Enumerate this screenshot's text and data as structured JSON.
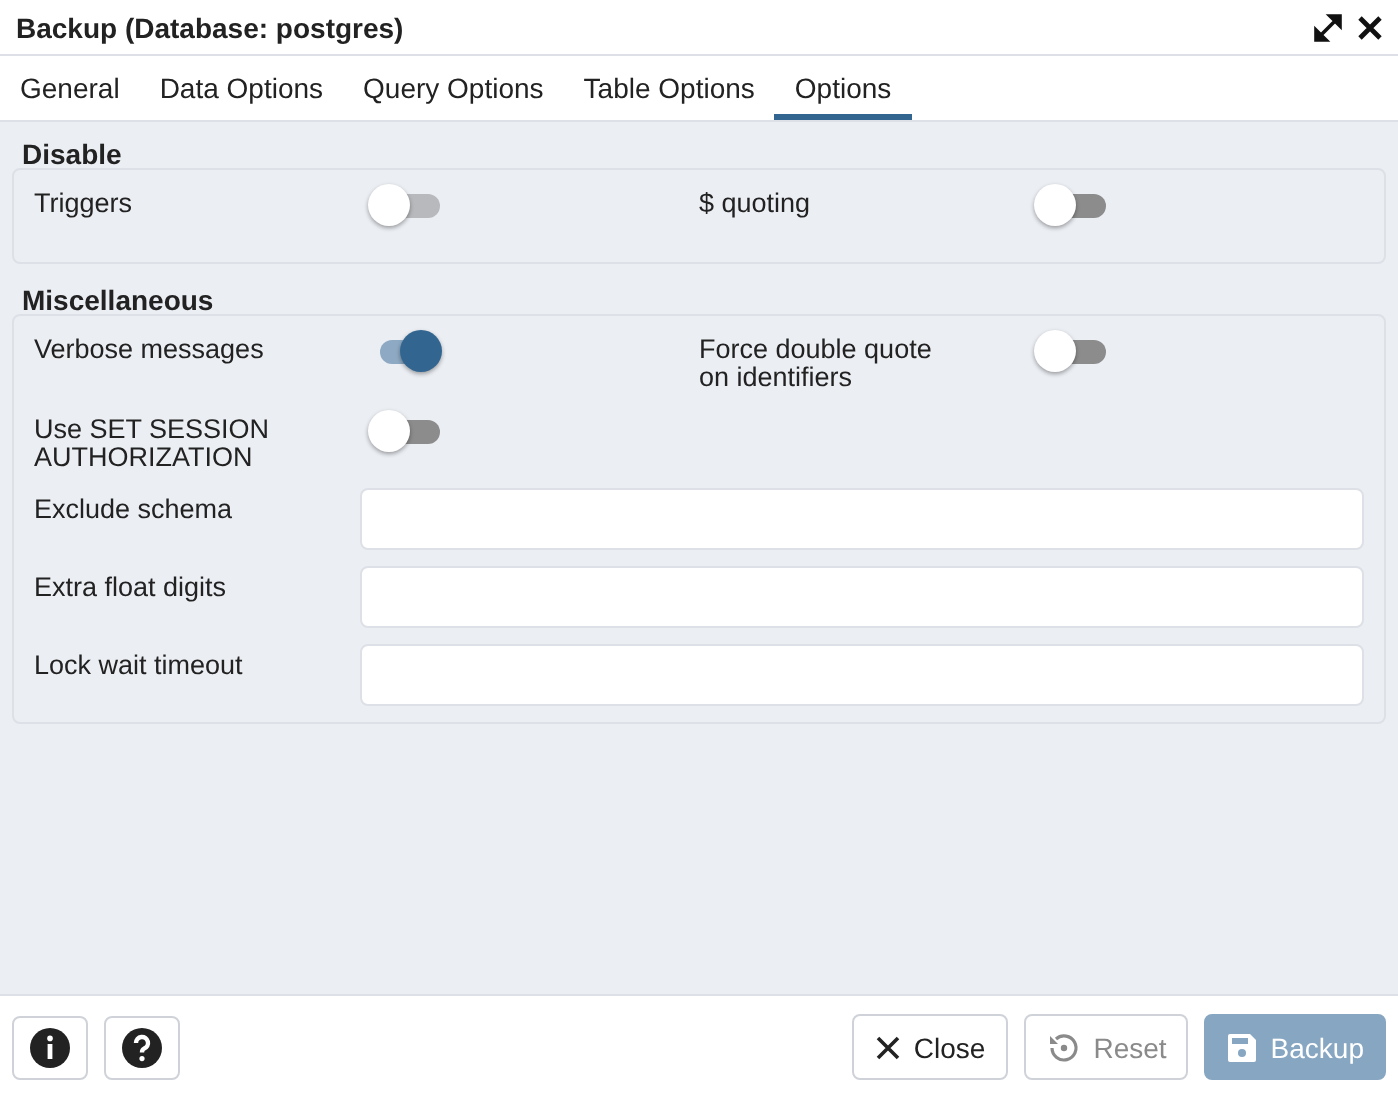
{
  "window": {
    "title": "Backup (Database: postgres)"
  },
  "tabs": [
    {
      "label": "General",
      "selected": false
    },
    {
      "label": "Data Options",
      "selected": false
    },
    {
      "label": "Query Options",
      "selected": false
    },
    {
      "label": "Table Options",
      "selected": false
    },
    {
      "label": "Options",
      "selected": true
    }
  ],
  "sections": [
    {
      "title": "Disable",
      "rows": [
        {
          "kind": "switches",
          "items": [
            {
              "label": "Triggers",
              "on": false,
              "disabled": true
            },
            {
              "label": "$ quoting",
              "on": false,
              "disabled": false
            }
          ]
        }
      ]
    },
    {
      "title": "Miscellaneous",
      "rows": [
        {
          "kind": "switches",
          "items": [
            {
              "label": "Verbose messages",
              "on": true,
              "disabled": false
            },
            {
              "label": "Force double quote on identifiers",
              "on": false,
              "disabled": false
            }
          ]
        },
        {
          "kind": "switches",
          "items": [
            {
              "label": "Use SET SESSION AUTHORIZATION",
              "on": false,
              "disabled": false
            }
          ]
        },
        {
          "kind": "field",
          "label": "Exclude schema"
        },
        {
          "kind": "field",
          "label": "Extra float digits"
        },
        {
          "kind": "field",
          "label": "Lock wait timeout"
        }
      ]
    }
  ],
  "footer": {
    "buttons": [
      {
        "kind": "close",
        "label": "Close",
        "disabled": false
      },
      {
        "kind": "reset",
        "label": "Reset",
        "disabled": true
      },
      {
        "kind": "backup",
        "label": "Backup",
        "disabled": true
      }
    ]
  }
}
